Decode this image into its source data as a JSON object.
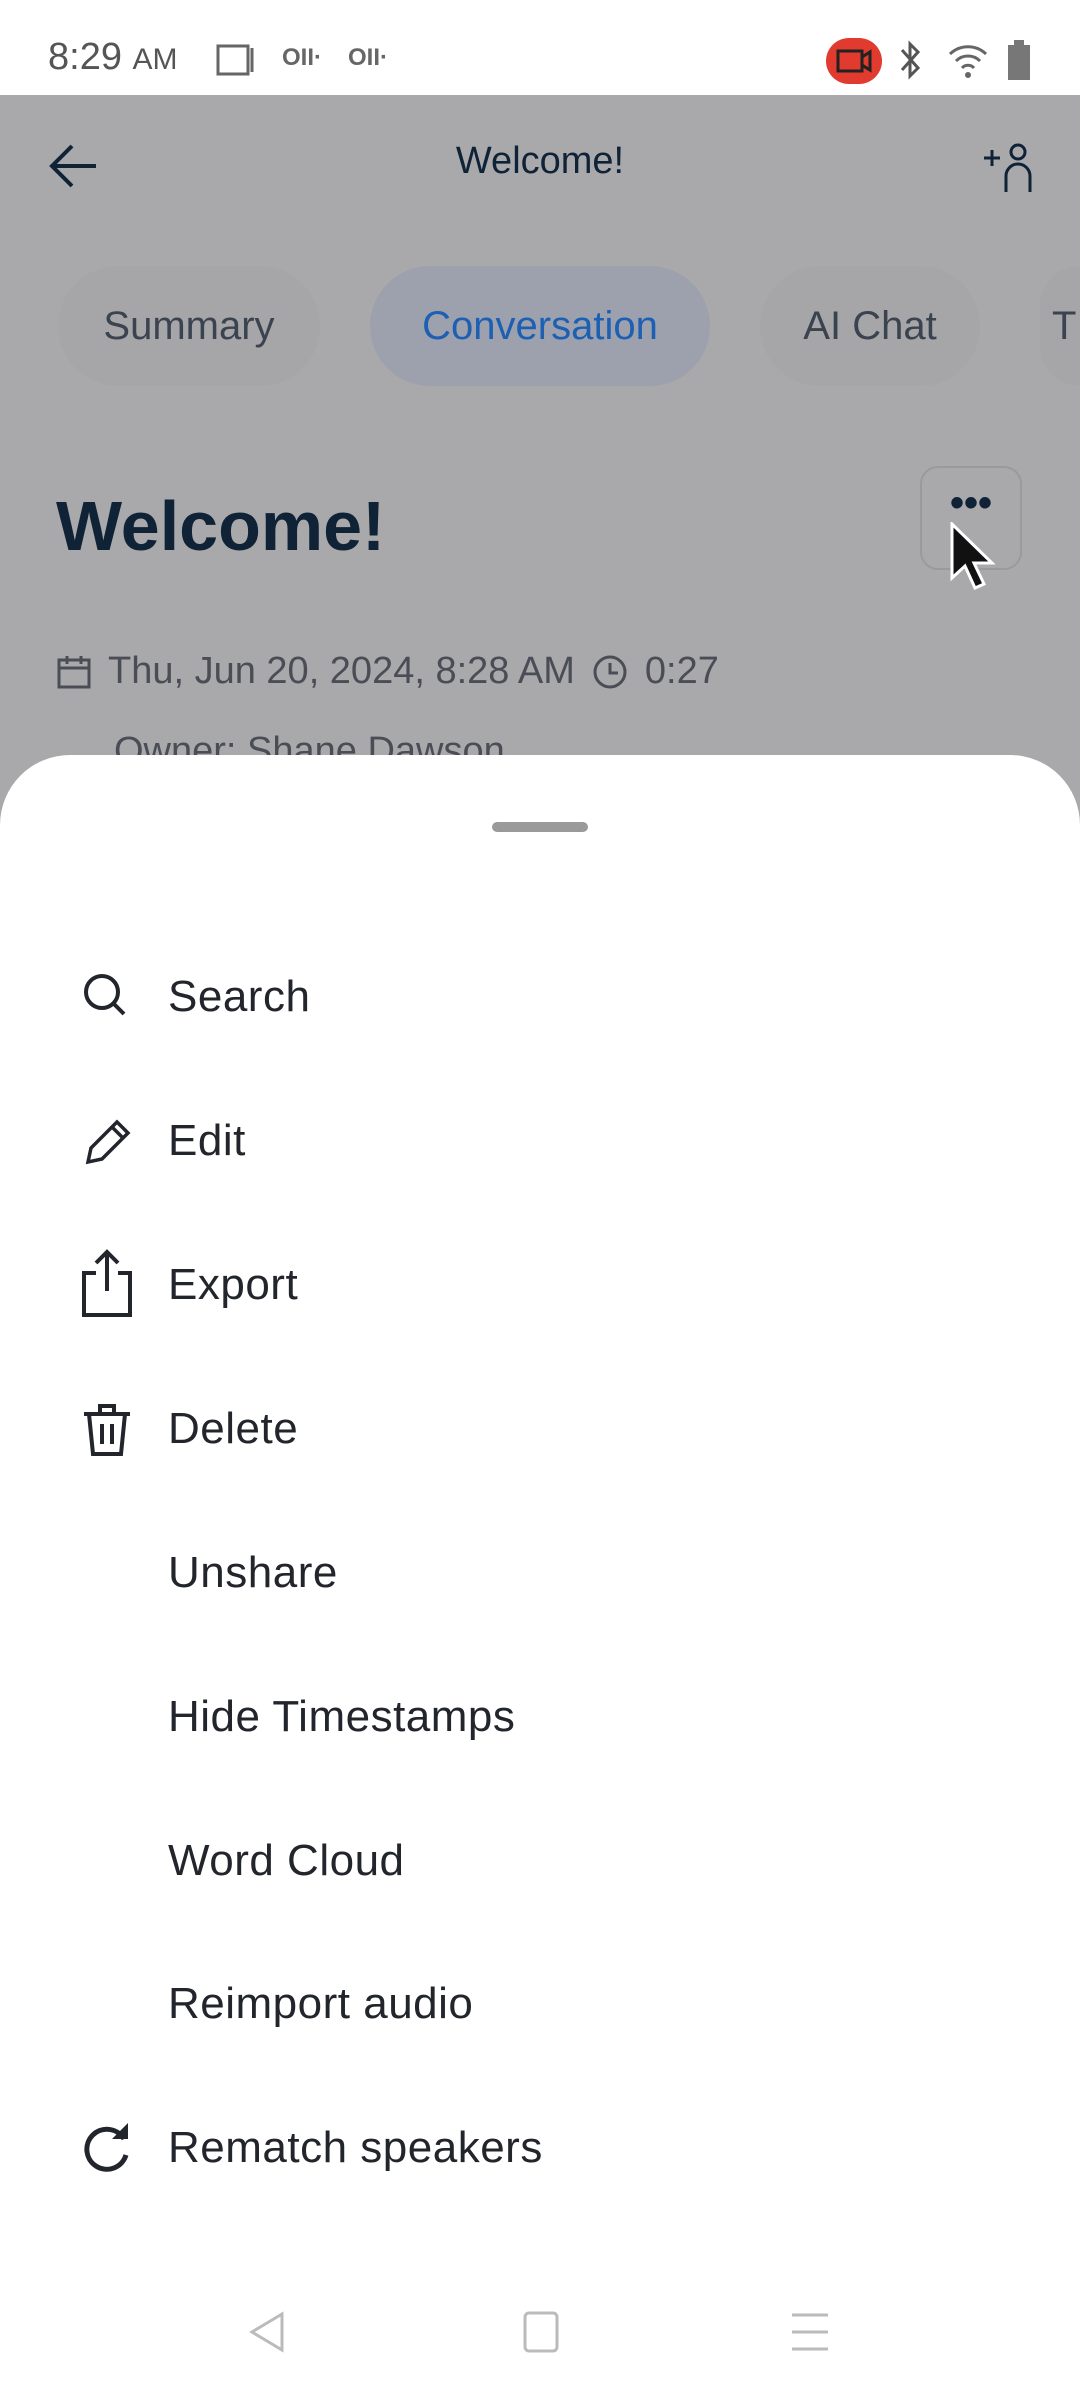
{
  "status_bar": {
    "time": "8:29",
    "ampm": "AM",
    "recording_color": "#e03b2e"
  },
  "header": {
    "title": "Welcome!",
    "back_icon": "arrow-left-icon",
    "add_person_icon": "add-person-icon"
  },
  "tabs": [
    {
      "label": "Summary",
      "active": false
    },
    {
      "label": "Conversation",
      "active": true
    },
    {
      "label": "AI Chat",
      "active": false
    },
    {
      "label": "T",
      "active": false
    }
  ],
  "note": {
    "title": "Welcome!",
    "date": "Thu, Jun 20, 2024, 8:28 AM",
    "duration": "0:27",
    "owner": "Owner: Shane Dawson"
  },
  "menu": {
    "items": [
      {
        "label": "Search",
        "icon": "search-icon"
      },
      {
        "label": "Edit",
        "icon": "pencil-icon"
      },
      {
        "label": "Export",
        "icon": "share-icon"
      },
      {
        "label": "Delete",
        "icon": "trash-icon"
      },
      {
        "label": "Unshare",
        "icon": ""
      },
      {
        "label": "Hide Timestamps",
        "icon": ""
      },
      {
        "label": "Word Cloud",
        "icon": ""
      },
      {
        "label": "Reimport audio",
        "icon": ""
      },
      {
        "label": "Rematch speakers",
        "icon": "refresh-icon"
      }
    ]
  }
}
